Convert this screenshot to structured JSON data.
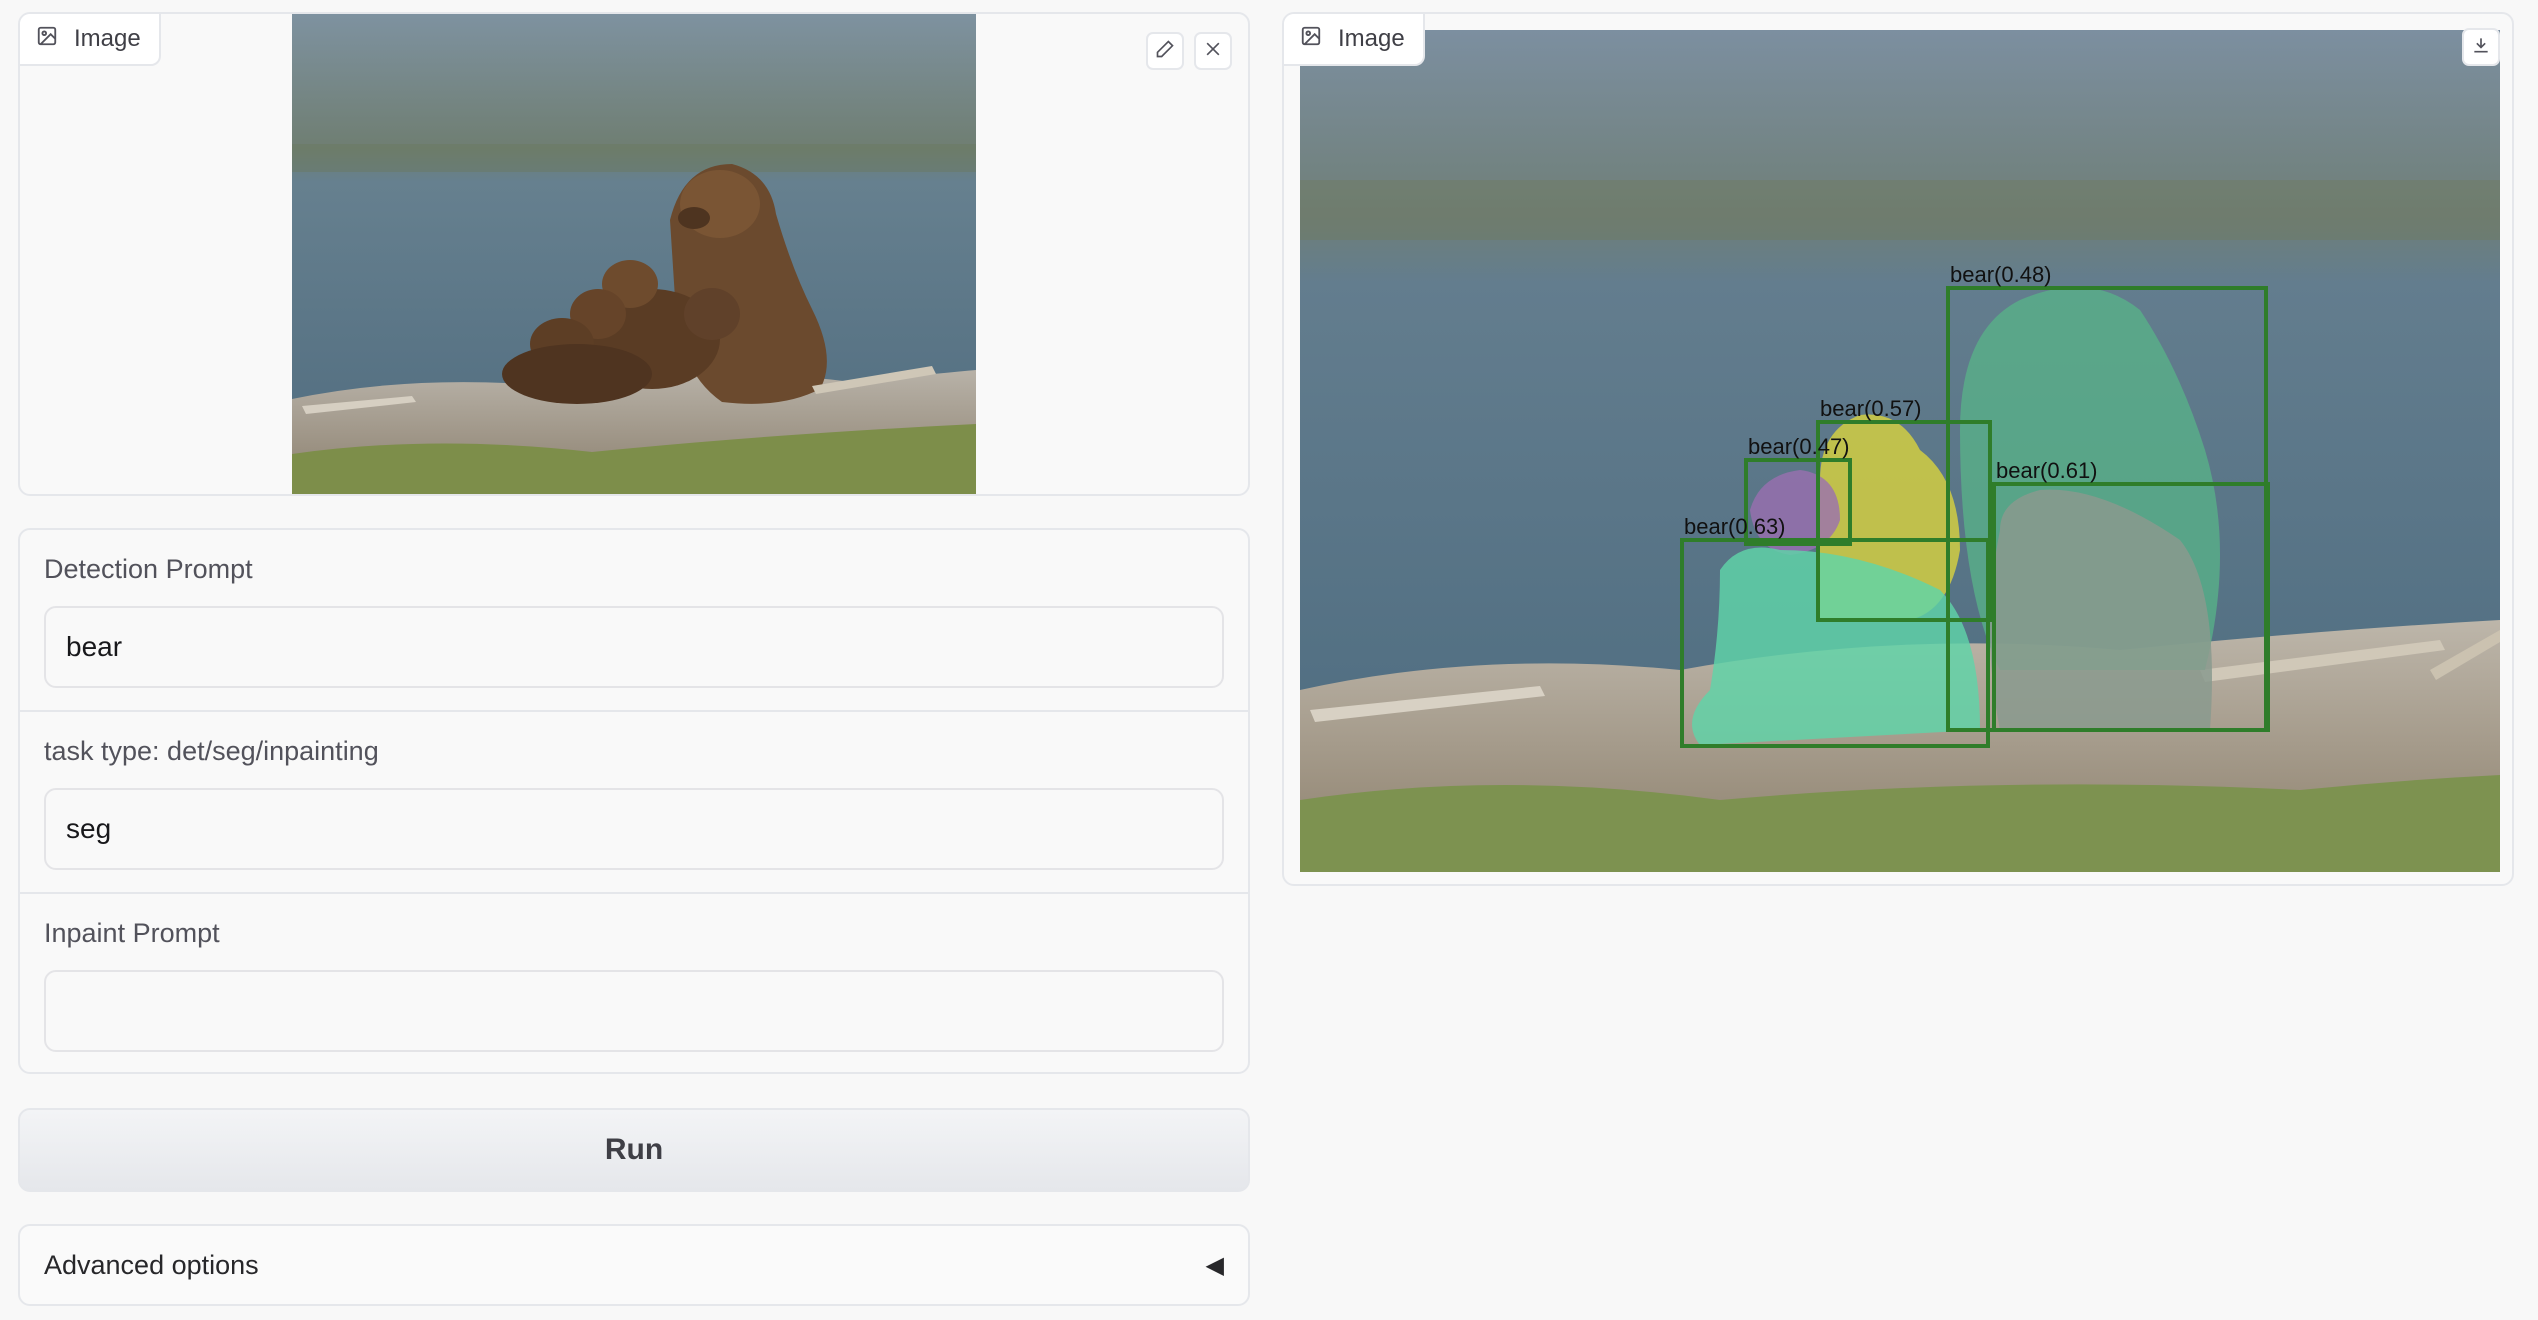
{
  "input_image": {
    "tag_label": "Image",
    "tag_icon": "image-icon",
    "edit_icon": "pencil-icon",
    "clear_icon": "close-icon"
  },
  "form": {
    "detection_prompt": {
      "label": "Detection Prompt",
      "value": "bear"
    },
    "task_type": {
      "label": "task type: det/seg/inpainting",
      "value": "seg"
    },
    "inpaint_prompt": {
      "label": "Inpaint Prompt",
      "value": ""
    }
  },
  "run_button": {
    "label": "Run"
  },
  "advanced": {
    "label": "Advanced options",
    "caret": "◀"
  },
  "output_image": {
    "tag_label": "Image",
    "tag_icon": "image-icon",
    "download_icon": "download-icon",
    "detections": [
      {
        "label": "bear(0.48)"
      },
      {
        "label": "bear(0.57)"
      },
      {
        "label": "bear(0.47)"
      },
      {
        "label": "bear(0.61)"
      },
      {
        "label": "bear(0.63)"
      }
    ]
  },
  "colors": {
    "box_green": "#2f7d2a",
    "mask_green": "#58b488",
    "mask_teal": "#5fd4a8",
    "mask_yellow": "#d9d33d",
    "mask_purple": "#9a6fb0",
    "mask_gray": "#8a9a8e"
  }
}
